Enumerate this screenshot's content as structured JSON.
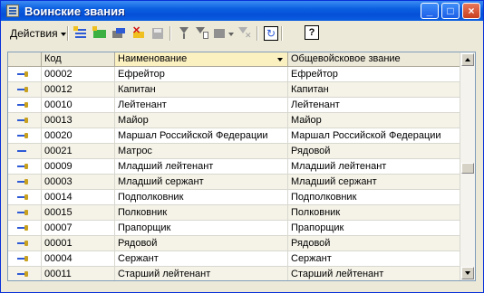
{
  "window": {
    "title": "Воинские звания",
    "minimize": "_",
    "maximize": "□",
    "close": "×"
  },
  "toolbar": {
    "actions_label": "Действия",
    "help_label": "?"
  },
  "table": {
    "columns": [
      "Код",
      "Наименование",
      "Общевойсковое звание"
    ],
    "sorted_column": "Наименование",
    "rows": [
      [
        "00002",
        "Ефрейтор",
        "Ефрейтор"
      ],
      [
        "00012",
        "Капитан",
        "Капитан"
      ],
      [
        "00010",
        "Лейтенант",
        "Лейтенант"
      ],
      [
        "00013",
        "Майор",
        "Майор"
      ],
      [
        "00020",
        "Маршал Российской Федерации",
        "Маршал Российской Федерации"
      ],
      [
        "00021",
        "Матрос",
        "Рядовой"
      ],
      [
        "00009",
        "Младший лейтенант",
        "Младший лейтенант"
      ],
      [
        "00003",
        "Младший сержант",
        "Младший сержант"
      ],
      [
        "00014",
        "Подполковник",
        "Подполковник"
      ],
      [
        "00015",
        "Полковник",
        "Полковник"
      ],
      [
        "00007",
        "Прапорщик",
        "Прапорщик"
      ],
      [
        "00001",
        "Рядовой",
        "Рядовой"
      ],
      [
        "00004",
        "Сержант",
        "Сержант"
      ],
      [
        "00011",
        "Старший лейтенант",
        "Старший лейтенант"
      ]
    ]
  }
}
